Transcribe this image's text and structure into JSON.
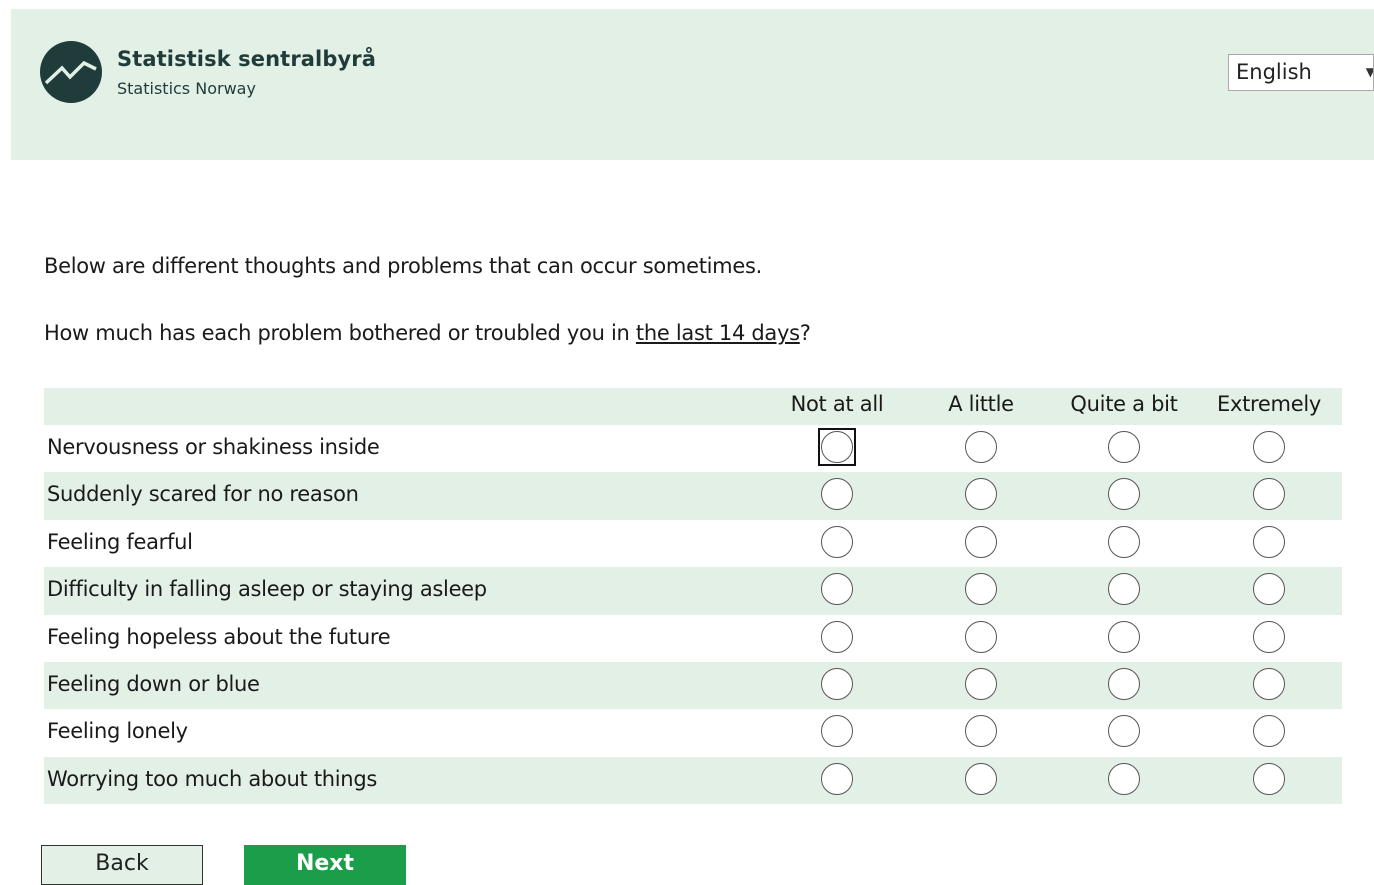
{
  "header": {
    "org_name": "Statistisk sentralbyrå",
    "org_subtitle": "Statistics Norway",
    "language": {
      "selected": "English"
    }
  },
  "survey": {
    "intro": "Below are different thoughts and problems that can occur sometimes.",
    "question_prefix": "How much has each problem bothered or troubled you in ",
    "question_emphasis": "the last 14 days",
    "question_suffix": "?",
    "columns": [
      "Not at all",
      "A little",
      "Quite a bit",
      "Extremely"
    ],
    "rows": [
      "Nervousness or shakiness inside",
      "Suddenly scared for no reason",
      "Feeling fearful",
      "Difficulty in falling asleep or staying asleep",
      "Feeling hopeless about the future",
      "Feeling down or blue",
      "Feeling lonely",
      "Worrying too much about things"
    ],
    "focused_cell": {
      "row": 0,
      "column": 0
    }
  },
  "nav": {
    "back_label": "Back",
    "next_label": "Next"
  },
  "colors": {
    "accent_bg": "#e3f0e6",
    "primary_button": "#1a9e4a",
    "logo": "#1f3b3a"
  },
  "icons": {
    "logo": "ssb-logo-icon",
    "dropdown": "chevron-down-icon"
  }
}
